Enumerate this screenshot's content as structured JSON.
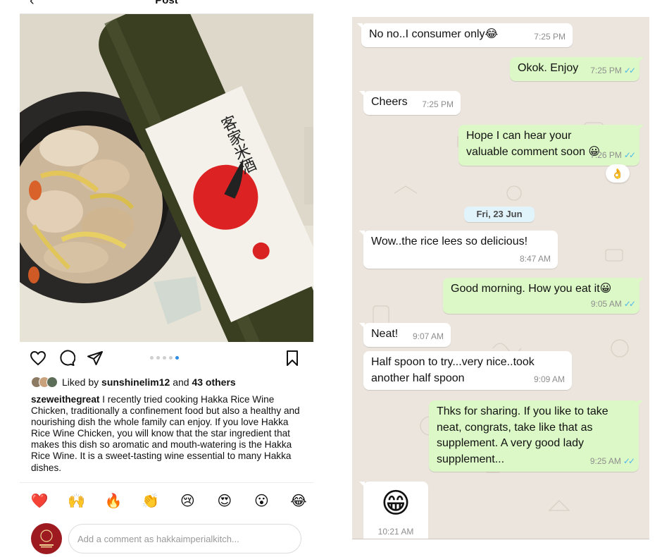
{
  "instagram": {
    "header_title": "Post",
    "back_icon": "chevron-left-icon",
    "carousel": {
      "count": 5,
      "active_index": 4
    },
    "likes": {
      "prefix": "Liked by",
      "user": "sunshinelim12",
      "joiner": "and",
      "others": "43 others"
    },
    "caption": {
      "username": "szeweithegreat",
      "text": "I recently tried cooking Hakka Rice Wine Chicken, traditionally a confinement food but also a healthy and nourishing dish the whole family can enjoy. If you love Hakka Rice Wine Chicken, you will know that the star ingredient that makes this dish so aromatic and mouth-watering is the Hakka Rice Wine. It is a sweet-tasting wine essential to many Hakka dishes."
    },
    "photo_label": {
      "chinese_title": "客家米酒"
    },
    "quick_reactions": [
      "❤️",
      "🙌",
      "🔥",
      "👏",
      "😢",
      "😍",
      "😮",
      "😂"
    ],
    "comment": {
      "placeholder": "Add a comment as hakkaimperialkitch..."
    },
    "colors": {
      "accent_dot": "#2e8ce6",
      "logo_red": "#9d1b20"
    }
  },
  "whatsapp": {
    "messages": [
      {
        "dir": "in",
        "text": "No no..I consumer only😂",
        "time": "7:25 PM"
      },
      {
        "dir": "out",
        "text": "Okok. Enjoy",
        "time": "7:25 PM",
        "ticks": "✓✓"
      },
      {
        "dir": "in",
        "text": "Cheers",
        "time": "7:25 PM"
      },
      {
        "dir": "out",
        "text": "Hope I can hear your valuable comment soon 😀",
        "time": "7:26 PM",
        "ticks": "✓✓"
      },
      {
        "dir": "in",
        "text": "Wow..the rice lees so delicious!",
        "time": "8:47 AM"
      },
      {
        "dir": "out",
        "text": "Good morning. How you eat it😀",
        "time": "9:05 AM",
        "ticks": "✓✓"
      },
      {
        "dir": "in",
        "text": "Neat!",
        "time": "9:07 AM"
      },
      {
        "dir": "in",
        "text": "Half spoon to try...very nice..took another half spoon",
        "time": "9:09 AM"
      },
      {
        "dir": "out",
        "text": "Thks for sharing. If you like to take neat, congrats, take like that as supplement. A very good lady supplement...",
        "time": "9:25 AM",
        "ticks": "✓✓"
      },
      {
        "dir": "in",
        "text": "😁",
        "time": "10:21 AM"
      }
    ],
    "reaction": "👌",
    "date_chip": "Fri, 23 Jun",
    "colors": {
      "bg": "#ece5dd",
      "out_bubble": "#dcf8c6",
      "in_bubble": "#ffffff",
      "read_ticks": "#4fb6ec"
    }
  }
}
